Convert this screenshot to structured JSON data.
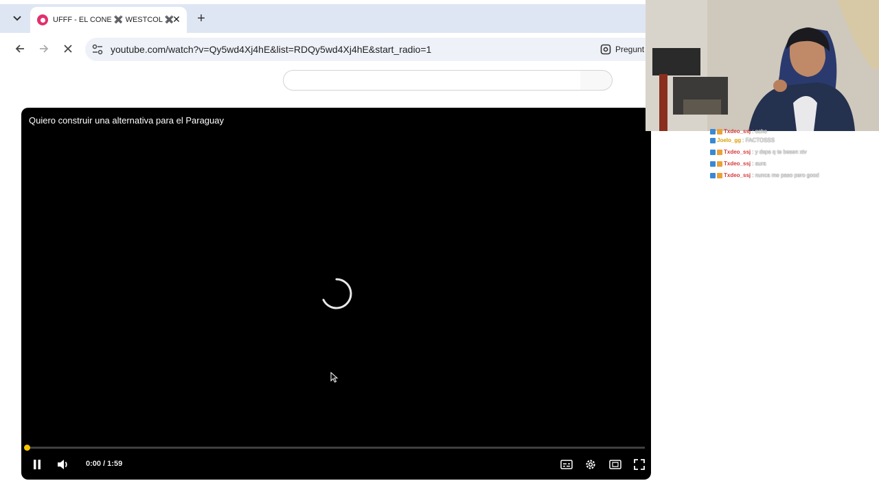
{
  "browser": {
    "tab_title": "UFFF - EL CONE ✖️ WESTCOL ✖️",
    "url": "youtube.com/watch?v=Qy5wd4Xj4hE&list=RDQy5wd4Xj4hE&start_radio=1",
    "ask_label": "Pregunt"
  },
  "player": {
    "title": "Quiero construir una alternativa para el Paraguay",
    "time": "0:00 / 1:59",
    "progress": 0.0
  },
  "chat": {
    "lines": [
      {
        "user": "Txdeo_ssj",
        "message": ": ocho",
        "color": "#d23a3a"
      },
      {
        "user": "Joelo_gg",
        "message": ": FACTOSSS",
        "color": "#d8a000"
      },
      {
        "user": "Txdeo_ssj",
        "message": ": y dsps q te besen xtv",
        "color": "#d23a3a"
      },
      {
        "user": "Txdeo_ssj",
        "message": ": aura",
        "color": "#d23a3a"
      },
      {
        "user": "Txdeo_ssj",
        "message": ": nunca me paso pero good",
        "color": "#d23a3a"
      }
    ]
  },
  "icons": {
    "tab_list": "chevron-down-icon",
    "back": "back-arrow-icon",
    "forward": "forward-arrow-icon",
    "stop": "stop-loading-icon",
    "site_info": "tune-icon",
    "lens": "google-lens-icon",
    "pause": "pause-icon",
    "volume": "volume-icon",
    "subtitles": "subtitles-icon",
    "settings": "settings-gear-icon",
    "theater": "theater-mode-icon",
    "fullscreen": "fullscreen-icon"
  },
  "colors": {
    "tabbar": "#dfe6f3",
    "omnibox": "#eef1f7",
    "player_bg": "#000000",
    "progress_accent": "#f5c400"
  }
}
